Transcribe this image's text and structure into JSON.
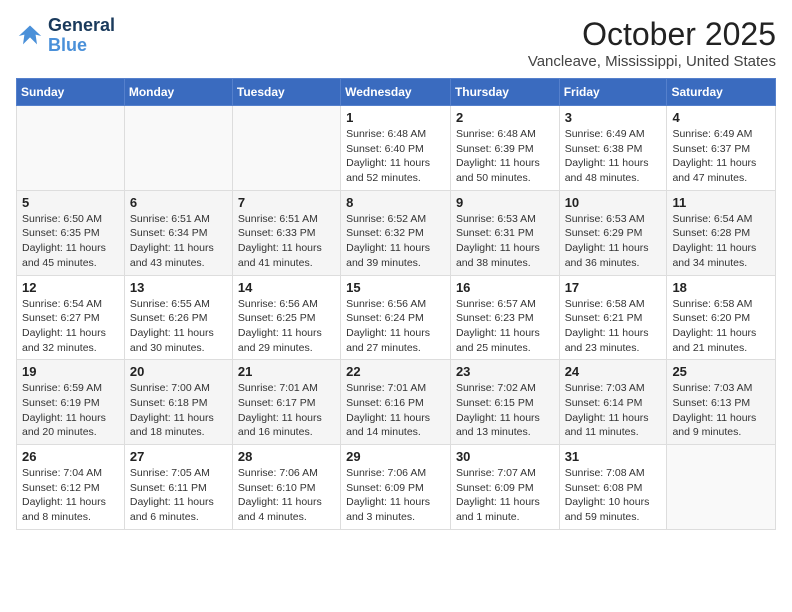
{
  "logo": {
    "line1": "General",
    "line2": "Blue"
  },
  "title": "October 2025",
  "location": "Vancleave, Mississippi, United States",
  "weekdays": [
    "Sunday",
    "Monday",
    "Tuesday",
    "Wednesday",
    "Thursday",
    "Friday",
    "Saturday"
  ],
  "weeks": [
    [
      {
        "day": "",
        "info": ""
      },
      {
        "day": "",
        "info": ""
      },
      {
        "day": "",
        "info": ""
      },
      {
        "day": "1",
        "info": "Sunrise: 6:48 AM\nSunset: 6:40 PM\nDaylight: 11 hours\nand 52 minutes."
      },
      {
        "day": "2",
        "info": "Sunrise: 6:48 AM\nSunset: 6:39 PM\nDaylight: 11 hours\nand 50 minutes."
      },
      {
        "day": "3",
        "info": "Sunrise: 6:49 AM\nSunset: 6:38 PM\nDaylight: 11 hours\nand 48 minutes."
      },
      {
        "day": "4",
        "info": "Sunrise: 6:49 AM\nSunset: 6:37 PM\nDaylight: 11 hours\nand 47 minutes."
      }
    ],
    [
      {
        "day": "5",
        "info": "Sunrise: 6:50 AM\nSunset: 6:35 PM\nDaylight: 11 hours\nand 45 minutes."
      },
      {
        "day": "6",
        "info": "Sunrise: 6:51 AM\nSunset: 6:34 PM\nDaylight: 11 hours\nand 43 minutes."
      },
      {
        "day": "7",
        "info": "Sunrise: 6:51 AM\nSunset: 6:33 PM\nDaylight: 11 hours\nand 41 minutes."
      },
      {
        "day": "8",
        "info": "Sunrise: 6:52 AM\nSunset: 6:32 PM\nDaylight: 11 hours\nand 39 minutes."
      },
      {
        "day": "9",
        "info": "Sunrise: 6:53 AM\nSunset: 6:31 PM\nDaylight: 11 hours\nand 38 minutes."
      },
      {
        "day": "10",
        "info": "Sunrise: 6:53 AM\nSunset: 6:29 PM\nDaylight: 11 hours\nand 36 minutes."
      },
      {
        "day": "11",
        "info": "Sunrise: 6:54 AM\nSunset: 6:28 PM\nDaylight: 11 hours\nand 34 minutes."
      }
    ],
    [
      {
        "day": "12",
        "info": "Sunrise: 6:54 AM\nSunset: 6:27 PM\nDaylight: 11 hours\nand 32 minutes."
      },
      {
        "day": "13",
        "info": "Sunrise: 6:55 AM\nSunset: 6:26 PM\nDaylight: 11 hours\nand 30 minutes."
      },
      {
        "day": "14",
        "info": "Sunrise: 6:56 AM\nSunset: 6:25 PM\nDaylight: 11 hours\nand 29 minutes."
      },
      {
        "day": "15",
        "info": "Sunrise: 6:56 AM\nSunset: 6:24 PM\nDaylight: 11 hours\nand 27 minutes."
      },
      {
        "day": "16",
        "info": "Sunrise: 6:57 AM\nSunset: 6:23 PM\nDaylight: 11 hours\nand 25 minutes."
      },
      {
        "day": "17",
        "info": "Sunrise: 6:58 AM\nSunset: 6:21 PM\nDaylight: 11 hours\nand 23 minutes."
      },
      {
        "day": "18",
        "info": "Sunrise: 6:58 AM\nSunset: 6:20 PM\nDaylight: 11 hours\nand 21 minutes."
      }
    ],
    [
      {
        "day": "19",
        "info": "Sunrise: 6:59 AM\nSunset: 6:19 PM\nDaylight: 11 hours\nand 20 minutes."
      },
      {
        "day": "20",
        "info": "Sunrise: 7:00 AM\nSunset: 6:18 PM\nDaylight: 11 hours\nand 18 minutes."
      },
      {
        "day": "21",
        "info": "Sunrise: 7:01 AM\nSunset: 6:17 PM\nDaylight: 11 hours\nand 16 minutes."
      },
      {
        "day": "22",
        "info": "Sunrise: 7:01 AM\nSunset: 6:16 PM\nDaylight: 11 hours\nand 14 minutes."
      },
      {
        "day": "23",
        "info": "Sunrise: 7:02 AM\nSunset: 6:15 PM\nDaylight: 11 hours\nand 13 minutes."
      },
      {
        "day": "24",
        "info": "Sunrise: 7:03 AM\nSunset: 6:14 PM\nDaylight: 11 hours\nand 11 minutes."
      },
      {
        "day": "25",
        "info": "Sunrise: 7:03 AM\nSunset: 6:13 PM\nDaylight: 11 hours\nand 9 minutes."
      }
    ],
    [
      {
        "day": "26",
        "info": "Sunrise: 7:04 AM\nSunset: 6:12 PM\nDaylight: 11 hours\nand 8 minutes."
      },
      {
        "day": "27",
        "info": "Sunrise: 7:05 AM\nSunset: 6:11 PM\nDaylight: 11 hours\nand 6 minutes."
      },
      {
        "day": "28",
        "info": "Sunrise: 7:06 AM\nSunset: 6:10 PM\nDaylight: 11 hours\nand 4 minutes."
      },
      {
        "day": "29",
        "info": "Sunrise: 7:06 AM\nSunset: 6:09 PM\nDaylight: 11 hours\nand 3 minutes."
      },
      {
        "day": "30",
        "info": "Sunrise: 7:07 AM\nSunset: 6:09 PM\nDaylight: 11 hours\nand 1 minute."
      },
      {
        "day": "31",
        "info": "Sunrise: 7:08 AM\nSunset: 6:08 PM\nDaylight: 10 hours\nand 59 minutes."
      },
      {
        "day": "",
        "info": ""
      }
    ]
  ]
}
